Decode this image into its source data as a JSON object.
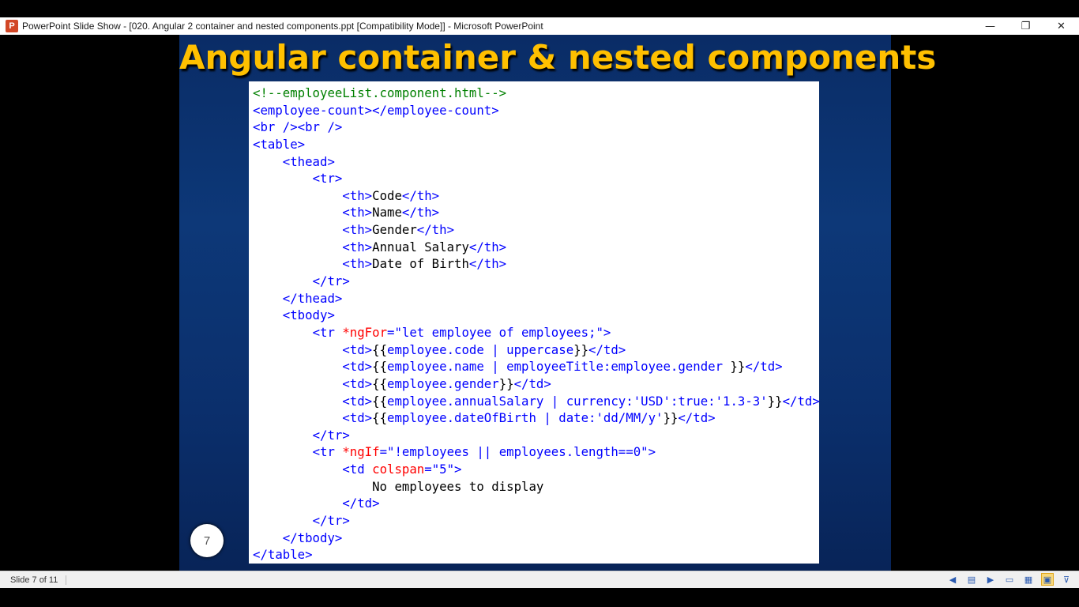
{
  "window": {
    "title": "PowerPoint Slide Show - [020. Angular 2 container and nested components.ppt [Compatibility Mode]] - Microsoft PowerPoint",
    "app_icon": "P",
    "controls": {
      "minimize": "—",
      "restore": "❐",
      "close": "✕"
    }
  },
  "slide": {
    "title": "Angular container & nested components",
    "number": "7",
    "code_lines": [
      [
        [
          "c",
          "<!--employeeList.component.html-->"
        ]
      ],
      [
        [
          "t",
          "<employee-count></employee-count>"
        ]
      ],
      [
        [
          "t",
          "<br /><br />"
        ]
      ],
      [
        [
          "t",
          "<table>"
        ]
      ],
      [
        [
          "k",
          "    "
        ],
        [
          "t",
          "<thead>"
        ]
      ],
      [
        [
          "k",
          "        "
        ],
        [
          "t",
          "<tr>"
        ]
      ],
      [
        [
          "k",
          "            "
        ],
        [
          "t",
          "<th>"
        ],
        [
          "k",
          "Code"
        ],
        [
          "t",
          "</th>"
        ]
      ],
      [
        [
          "k",
          "            "
        ],
        [
          "t",
          "<th>"
        ],
        [
          "k",
          "Name"
        ],
        [
          "t",
          "</th>"
        ]
      ],
      [
        [
          "k",
          "            "
        ],
        [
          "t",
          "<th>"
        ],
        [
          "k",
          "Gender"
        ],
        [
          "t",
          "</th>"
        ]
      ],
      [
        [
          "k",
          "            "
        ],
        [
          "t",
          "<th>"
        ],
        [
          "k",
          "Annual Salary"
        ],
        [
          "t",
          "</th>"
        ]
      ],
      [
        [
          "k",
          "            "
        ],
        [
          "t",
          "<th>"
        ],
        [
          "k",
          "Date of Birth"
        ],
        [
          "t",
          "</th>"
        ]
      ],
      [
        [
          "k",
          "        "
        ],
        [
          "t",
          "</tr>"
        ]
      ],
      [
        [
          "k",
          "    "
        ],
        [
          "t",
          "</thead>"
        ]
      ],
      [
        [
          "k",
          "    "
        ],
        [
          "t",
          "<tbody>"
        ]
      ],
      [
        [
          "k",
          "        "
        ],
        [
          "t",
          "<tr "
        ],
        [
          "a",
          "*ngFor"
        ],
        [
          "t",
          "=\"let employee of employees;\">"
        ]
      ],
      [
        [
          "k",
          "            "
        ],
        [
          "t",
          "<td>"
        ],
        [
          "k",
          "{{"
        ],
        [
          "t",
          "employee.code | uppercase"
        ],
        [
          "k",
          "}}"
        ],
        [
          "t",
          "</td>"
        ]
      ],
      [
        [
          "k",
          "            "
        ],
        [
          "t",
          "<td>"
        ],
        [
          "k",
          "{{"
        ],
        [
          "t",
          "employee.name | employeeTitle:employee.gender "
        ],
        [
          "k",
          "}}"
        ],
        [
          "t",
          "</td>"
        ]
      ],
      [
        [
          "k",
          "            "
        ],
        [
          "t",
          "<td>"
        ],
        [
          "k",
          "{{"
        ],
        [
          "t",
          "employee.gender"
        ],
        [
          "k",
          "}}"
        ],
        [
          "t",
          "</td>"
        ]
      ],
      [
        [
          "k",
          "            "
        ],
        [
          "t",
          "<td>"
        ],
        [
          "k",
          "{{"
        ],
        [
          "t",
          "employee.annualSalary | currency:'USD':true:'1.3-3'"
        ],
        [
          "k",
          "}}"
        ],
        [
          "t",
          "</td>"
        ]
      ],
      [
        [
          "k",
          "            "
        ],
        [
          "t",
          "<td>"
        ],
        [
          "k",
          "{{"
        ],
        [
          "t",
          "employee.dateOfBirth | date:'dd/MM/y'"
        ],
        [
          "k",
          "}}"
        ],
        [
          "t",
          "</td>"
        ]
      ],
      [
        [
          "k",
          "        "
        ],
        [
          "t",
          "</tr>"
        ]
      ],
      [
        [
          "k",
          "        "
        ],
        [
          "t",
          "<tr "
        ],
        [
          "a",
          "*ngIf"
        ],
        [
          "t",
          "=\"!employees || employees.length==0\">"
        ]
      ],
      [
        [
          "k",
          "            "
        ],
        [
          "t",
          "<td "
        ],
        [
          "a",
          "colspan"
        ],
        [
          "t",
          "=\"5\">"
        ]
      ],
      [
        [
          "k",
          "                No employees to display"
        ]
      ],
      [
        [
          "k",
          "            "
        ],
        [
          "t",
          "</td>"
        ]
      ],
      [
        [
          "k",
          "        "
        ],
        [
          "t",
          "</tr>"
        ]
      ],
      [
        [
          "k",
          "    "
        ],
        [
          "t",
          "</tbody>"
        ]
      ],
      [
        [
          "t",
          "</table>"
        ]
      ]
    ]
  },
  "statusbar": {
    "slide_indicator": "Slide 7 of 11",
    "icons": [
      "previous-icon",
      "notes-icon",
      "next-icon",
      "normal-view-icon",
      "slide-sorter-icon",
      "reading-view-icon",
      "slideshow-icon"
    ],
    "icon_glyphs": [
      "◀",
      "▤",
      "▶",
      "▭",
      "▦",
      "▣",
      "⊽"
    ]
  },
  "colors": {
    "title": "#ffc000",
    "tag": "#0000ff",
    "attribute": "#ff0000",
    "comment": "#008000",
    "slide_bg": "#0d3878"
  }
}
